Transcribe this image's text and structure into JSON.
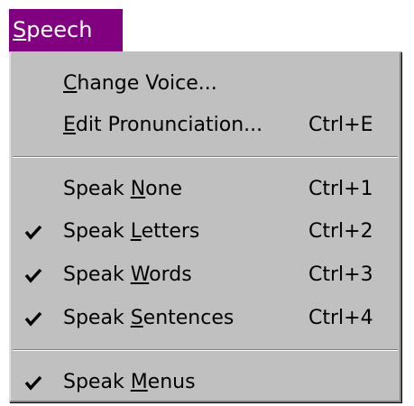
{
  "menu": {
    "title": {
      "mnemonic": "S",
      "rest": "peech"
    },
    "items": [
      {
        "checked": false,
        "pre": "",
        "mnemonic": "C",
        "post": "hange Voice...",
        "shortcut": ""
      },
      {
        "checked": false,
        "pre": "",
        "mnemonic": "E",
        "post": "dit Pronunciation...",
        "shortcut": "Ctrl+E"
      },
      {
        "checked": false,
        "pre": "Speak ",
        "mnemonic": "N",
        "post": "one",
        "shortcut": "Ctrl+1"
      },
      {
        "checked": true,
        "pre": "Speak ",
        "mnemonic": "L",
        "post": "etters",
        "shortcut": "Ctrl+2"
      },
      {
        "checked": true,
        "pre": "Speak ",
        "mnemonic": "W",
        "post": "ords",
        "shortcut": "Ctrl+3"
      },
      {
        "checked": true,
        "pre": "Speak ",
        "mnemonic": "S",
        "post": "entences",
        "shortcut": "Ctrl+4"
      },
      {
        "checked": true,
        "pre": "Speak ",
        "mnemonic": "M",
        "post": "enus",
        "shortcut": ""
      }
    ]
  },
  "colors": {
    "title_bg": "#800080",
    "menu_bg": "#c0c0c0"
  },
  "icons": {
    "check": "check-icon"
  }
}
